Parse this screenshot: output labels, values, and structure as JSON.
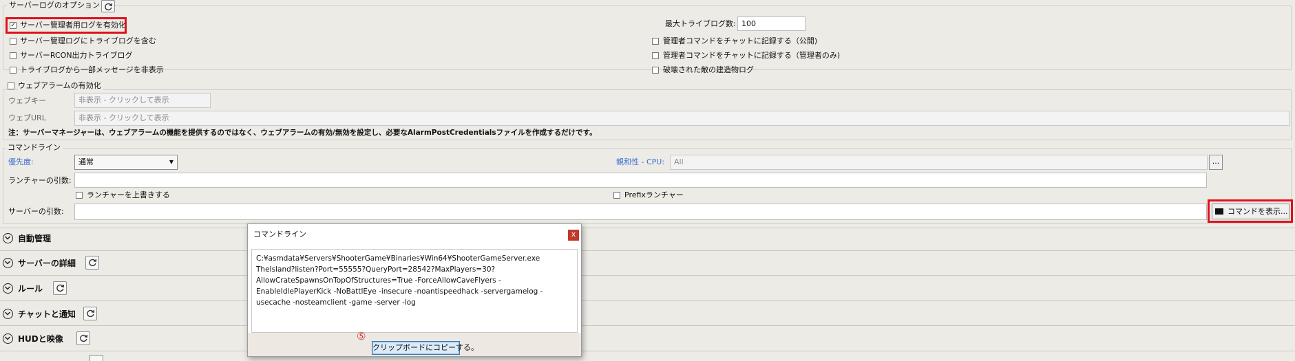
{
  "server_log_options": {
    "title": "サーバーログのオプション",
    "enable_admin_log": {
      "label": "サーバー管理者用ログを有効化",
      "checked": true
    },
    "include_tribe_logs": {
      "label": "サーバー管理ログにトライブログを含む",
      "checked": false
    },
    "rcon_tribe_log": {
      "label": "サーバーRCON出力トライブログ",
      "checked": false
    },
    "hide_tribe_messages": {
      "label": "トライブログから一部メッセージを非表示",
      "checked": false
    },
    "max_tribe_logs_label": "最大トライブログ数:",
    "max_tribe_logs_value": "100",
    "admin_cmd_chat_public": {
      "label": "管理者コマンドをチャットに記録する（公開)",
      "checked": false
    },
    "admin_cmd_chat_admin": {
      "label": "管理者コマンドをチャットに記録する（管理者のみ)",
      "checked": false
    },
    "destroyed_structures_log": {
      "label": "破壊された敵の建造物ログ",
      "checked": false
    }
  },
  "web_alarm": {
    "enable_label": "ウェブアラームの有効化",
    "key_label": "ウェブキー",
    "key_placeholder": "非表示 - クリックして表示",
    "url_label": "ウェブURL",
    "url_placeholder": "非表示 - クリックして表示",
    "note": "注：サーバーマネージャーは、ウェブアラームの機能を提供するのではなく、ウェブアラームの有効/無効を設定し、必要なAlarmPostCredentialsファイルを作成するだけです。"
  },
  "command_line": {
    "title": "コマンドライン",
    "priority_label": "優先度:",
    "priority_value": "通常",
    "affinity_label": "親和性 - CPU:",
    "affinity_value": "All",
    "ellipsis_label": "...",
    "launcher_args_label": "ランチャーの引数:",
    "override_launcher_label": "ランチャーを上書きする",
    "prefix_launcher_label": "Prefixランチャー",
    "server_args_label": "サーバーの引数:",
    "show_command_label": "コマンドを表示..."
  },
  "sections": [
    {
      "label": "自動管理",
      "refresh": false
    },
    {
      "label": "サーバーの詳細",
      "refresh": true
    },
    {
      "label": "ルール",
      "refresh": true
    },
    {
      "label": "チャットと通知",
      "refresh": true
    },
    {
      "label": "HUDと映像",
      "refresh": true
    }
  ],
  "dialog": {
    "title": "コマンドライン",
    "close_label": "x",
    "command_lines": [
      "C:¥asmdata¥Servers¥ShooterGame¥Binaries¥Win64¥ShooterGameServer.exe",
      "TheIsland?listen?Port=55555?QueryPort=28542?MaxPlayers=30?",
      "AllowCrateSpawnsOnTopOfStructures=True -ForceAllowCaveFlyers -",
      "EnableIdlePlayerKick -NoBattlEye -insecure -noantispeedhack -servergamelog -",
      "usecache -nosteamclient -game -server -log"
    ],
    "step_marker": "⑤",
    "copy_button_label": "クリップボードにコピーする。"
  },
  "colors": {
    "highlight_red": "#e0101a",
    "link_blue": "#3b6fd6",
    "dialog_close_red": "#c0392b"
  }
}
